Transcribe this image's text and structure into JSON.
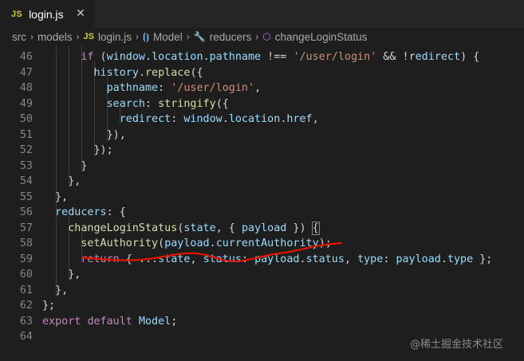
{
  "tab": {
    "icon": "JS",
    "icon_name": "javascript-file-icon",
    "label": "login.js",
    "close": "✕"
  },
  "breadcrumb": {
    "items": [
      {
        "label": "src",
        "icon": ""
      },
      {
        "label": "models",
        "icon": ""
      },
      {
        "label": "login.js",
        "icon": "JS"
      },
      {
        "label": "Model",
        "icon": "⦗⦘"
      },
      {
        "label": "reducers",
        "icon": "🔧"
      },
      {
        "label": "changeLoginStatus",
        "icon": "⬡"
      }
    ]
  },
  "editor": {
    "line_numbers": [
      "46",
      "47",
      "48",
      "49",
      "50",
      "51",
      "52",
      "53",
      "54",
      "55",
      "56",
      "57",
      "58",
      "59",
      "60",
      "61",
      "62",
      "63",
      "64"
    ],
    "lines": [
      [
        {
          "t": "      ",
          "c": ""
        },
        {
          "t": "if",
          "c": "ctl"
        },
        {
          "t": " (",
          "c": ""
        },
        {
          "t": "window",
          "c": "var"
        },
        {
          "t": ".",
          "c": ""
        },
        {
          "t": "location",
          "c": "var"
        },
        {
          "t": ".",
          "c": ""
        },
        {
          "t": "pathname",
          "c": "var"
        },
        {
          "t": " !== ",
          "c": ""
        },
        {
          "t": "'/user/login'",
          "c": "str"
        },
        {
          "t": " && !",
          "c": ""
        },
        {
          "t": "redirect",
          "c": "var"
        },
        {
          "t": ") {",
          "c": ""
        }
      ],
      [
        {
          "t": "        ",
          "c": ""
        },
        {
          "t": "history",
          "c": "var"
        },
        {
          "t": ".",
          "c": ""
        },
        {
          "t": "replace",
          "c": "fn"
        },
        {
          "t": "({",
          "c": ""
        }
      ],
      [
        {
          "t": "          ",
          "c": ""
        },
        {
          "t": "pathname",
          "c": "var"
        },
        {
          "t": ": ",
          "c": ""
        },
        {
          "t": "'/user/login'",
          "c": "str"
        },
        {
          "t": ",",
          "c": ""
        }
      ],
      [
        {
          "t": "          ",
          "c": ""
        },
        {
          "t": "search",
          "c": "var"
        },
        {
          "t": ": ",
          "c": ""
        },
        {
          "t": "stringify",
          "c": "fn"
        },
        {
          "t": "({",
          "c": ""
        }
      ],
      [
        {
          "t": "            ",
          "c": ""
        },
        {
          "t": "redirect",
          "c": "var"
        },
        {
          "t": ": ",
          "c": ""
        },
        {
          "t": "window",
          "c": "var"
        },
        {
          "t": ".",
          "c": ""
        },
        {
          "t": "location",
          "c": "var"
        },
        {
          "t": ".",
          "c": ""
        },
        {
          "t": "href",
          "c": "var"
        },
        {
          "t": ",",
          "c": ""
        }
      ],
      [
        {
          "t": "          }),",
          "c": ""
        }
      ],
      [
        {
          "t": "        });",
          "c": ""
        }
      ],
      [
        {
          "t": "      }",
          "c": ""
        }
      ],
      [
        {
          "t": "    },",
          "c": ""
        }
      ],
      [
        {
          "t": "  },",
          "c": ""
        }
      ],
      [
        {
          "t": "  ",
          "c": ""
        },
        {
          "t": "reducers",
          "c": "var"
        },
        {
          "t": ": {",
          "c": ""
        }
      ],
      [
        {
          "t": "    ",
          "c": ""
        },
        {
          "t": "changeLoginStatus",
          "c": "fn"
        },
        {
          "t": "(",
          "c": ""
        },
        {
          "t": "state",
          "c": "var"
        },
        {
          "t": ", { ",
          "c": ""
        },
        {
          "t": "payload",
          "c": "var"
        },
        {
          "t": " }) ",
          "c": ""
        },
        {
          "t": "{",
          "c": "brace"
        }
      ],
      [
        {
          "t": "      ",
          "c": ""
        },
        {
          "t": "setAuthority",
          "c": "fn"
        },
        {
          "t": "(",
          "c": ""
        },
        {
          "t": "payload",
          "c": "var"
        },
        {
          "t": ".",
          "c": ""
        },
        {
          "t": "currentAuthority",
          "c": "var"
        },
        {
          "t": ");",
          "c": ""
        }
      ],
      [
        {
          "t": "      ",
          "c": ""
        },
        {
          "t": "return",
          "c": "ctl"
        },
        {
          "t": " { ...",
          "c": ""
        },
        {
          "t": "state",
          "c": "var"
        },
        {
          "t": ", ",
          "c": ""
        },
        {
          "t": "status",
          "c": "var"
        },
        {
          "t": ": ",
          "c": ""
        },
        {
          "t": "payload",
          "c": "var"
        },
        {
          "t": ".",
          "c": ""
        },
        {
          "t": "status",
          "c": "var"
        },
        {
          "t": ", ",
          "c": ""
        },
        {
          "t": "type",
          "c": "var"
        },
        {
          "t": ": ",
          "c": ""
        },
        {
          "t": "payload",
          "c": "var"
        },
        {
          "t": ".",
          "c": ""
        },
        {
          "t": "type",
          "c": "var"
        },
        {
          "t": " };",
          "c": ""
        }
      ],
      [
        {
          "t": "    },",
          "c": ""
        }
      ],
      [
        {
          "t": "  },",
          "c": ""
        }
      ],
      [
        {
          "t": "};",
          "c": ""
        }
      ],
      [
        {
          "t": "export",
          "c": "ctl"
        },
        {
          "t": " ",
          "c": ""
        },
        {
          "t": "default",
          "c": "ctl"
        },
        {
          "t": " ",
          "c": ""
        },
        {
          "t": "Model",
          "c": "var"
        },
        {
          "t": ";",
          "c": ""
        }
      ],
      []
    ]
  },
  "annotation": {
    "color": "#e51400"
  },
  "watermark": "@稀土掘金技术社区"
}
